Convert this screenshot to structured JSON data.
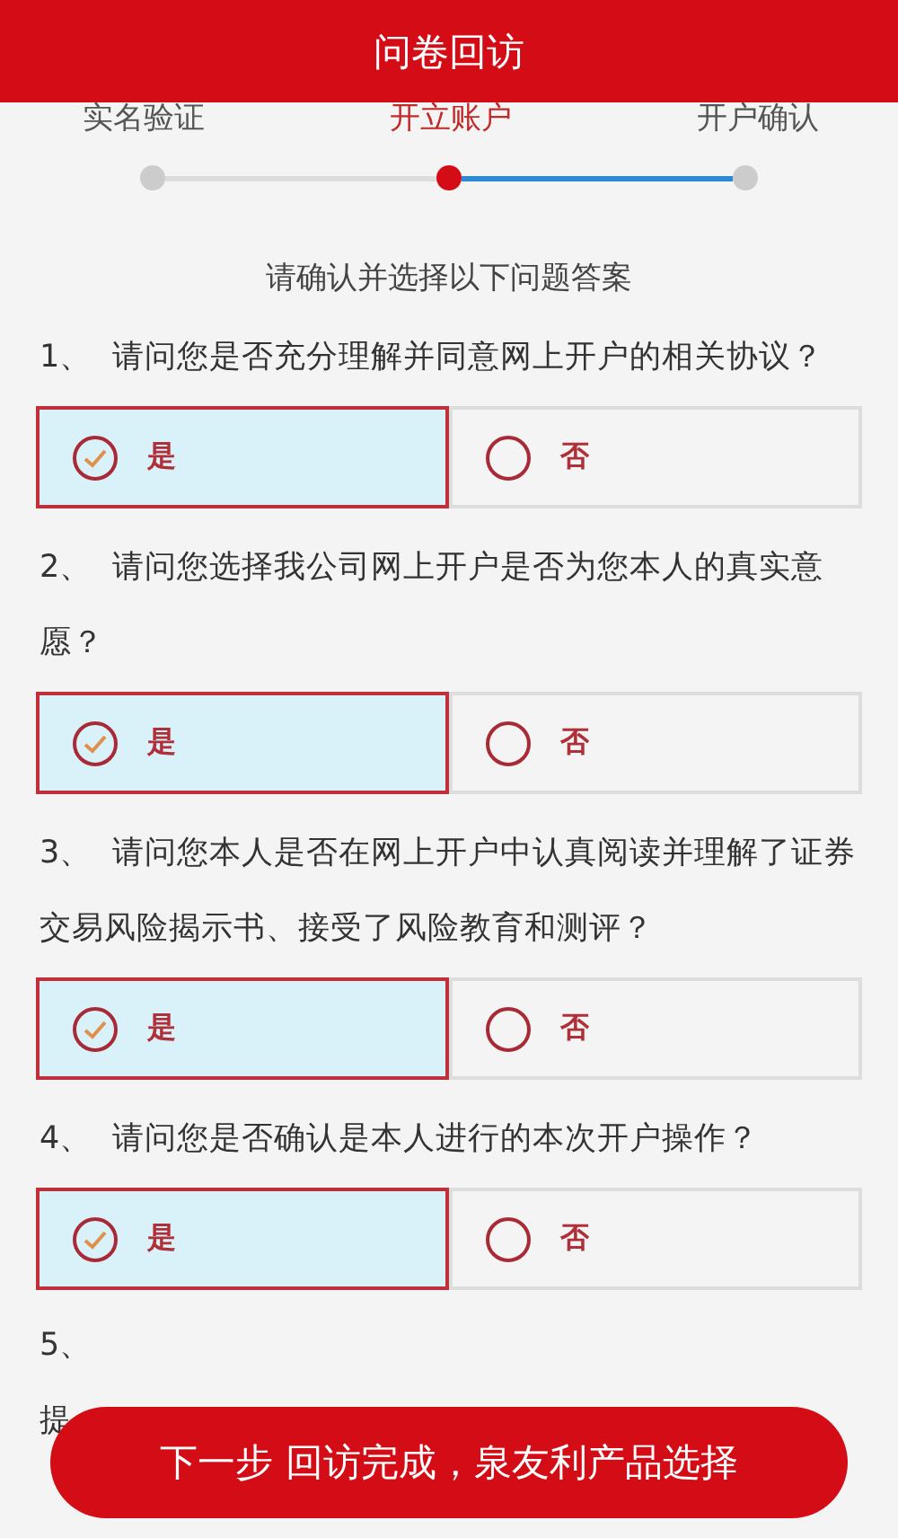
{
  "header": {
    "title": "问卷回访"
  },
  "steps": [
    {
      "label": "实名验证",
      "selected": false
    },
    {
      "label": "开立账户",
      "selected": true
    },
    {
      "label": "开户确认",
      "selected": false
    }
  ],
  "segments": [
    {
      "color": "#dddddd"
    },
    {
      "color": "#2a8ad4"
    }
  ],
  "instruction": "请确认并选择以下问题答案",
  "questions": [
    {
      "kind": "full",
      "number": "1、",
      "text": "请问您是否充分理解并同意网上开户的相关协议？",
      "options": [
        {
          "label": "是",
          "selected": true
        },
        {
          "label": "否",
          "selected": false
        }
      ]
    },
    {
      "kind": "full",
      "number": "2、",
      "text": "请问您选择我公司网上开户是否为您本人的真实意愿？",
      "options": [
        {
          "label": "是",
          "selected": true
        },
        {
          "label": "否",
          "selected": false
        }
      ]
    },
    {
      "kind": "full",
      "number": "3、",
      "text": "请问您本人是否在网上开户中认真阅读并理解了证券交易风险揭示书、接受了风险教育和测评？",
      "options": [
        {
          "label": "是",
          "selected": true
        },
        {
          "label": "否",
          "selected": false
        }
      ]
    },
    {
      "kind": "full",
      "number": "4、",
      "text": "请问您是否确认是本人进行的本次开户操作？",
      "options": [
        {
          "label": "是",
          "selected": true
        },
        {
          "label": "否",
          "selected": false
        }
      ]
    },
    {
      "kind": "cut",
      "number": "5、",
      "text": "提"
    }
  ],
  "next_button": {
    "label": "下一步 回访完成，泉友利产品选择"
  }
}
